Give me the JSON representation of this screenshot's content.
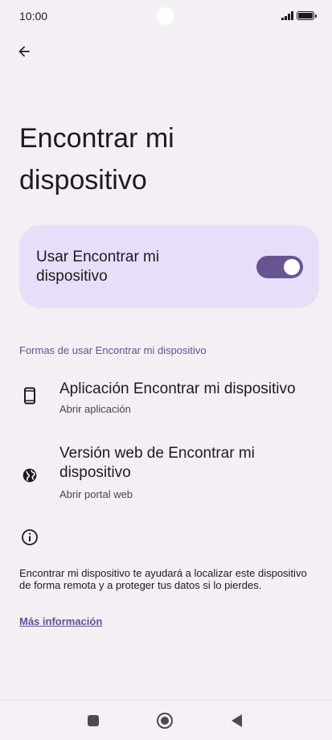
{
  "status_bar": {
    "time": "10:00"
  },
  "header": {
    "back_icon": "arrow-left-icon",
    "title": "Encontrar mi dispositivo"
  },
  "main_toggle": {
    "label": "Usar Encontrar mi dispositivo",
    "state": "on",
    "accent_color": "#66558f",
    "card_color": "#e8defa"
  },
  "section": {
    "header": "Formas de usar Encontrar mi dispositivo",
    "items": [
      {
        "icon": "phone-icon",
        "title": "Aplicación Encontrar mi dispositivo",
        "subtitle": "Abrir aplicación"
      },
      {
        "icon": "globe-icon",
        "title": "Versión web de Encontrar mi dispositivo",
        "subtitle": "Abrir portal web"
      }
    ]
  },
  "info": {
    "icon": "info-icon",
    "text": "Encontrar mi dispositivo te ayudará a localizar este dispositivo de forma remota y a proteger tus datos si lo pierdes.",
    "link": "Más información"
  },
  "nav_bar": {
    "recents_icon": "square-icon",
    "home_icon": "circle-icon",
    "back_icon": "triangle-back-icon"
  }
}
